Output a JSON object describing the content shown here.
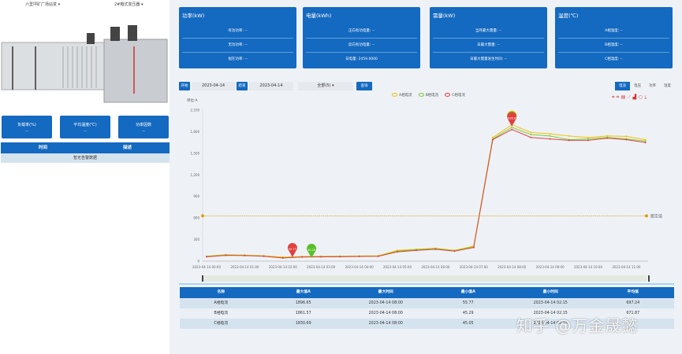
{
  "left": {
    "site_select": "六里坪矿广场站变 ▾",
    "device_select": "2#箱式变压器 ▾",
    "stats": [
      {
        "label": "负载率(%)",
        "value": "--"
      },
      {
        "label": "平均温度(℃)",
        "value": "--"
      },
      {
        "label": "功率因数",
        "value": "--"
      }
    ],
    "alarm_table": {
      "headers": [
        "时间",
        "描述"
      ],
      "empty": "暂无告警数据"
    }
  },
  "cards": [
    {
      "title": "功率(kW)",
      "rows": [
        "有功功率: --",
        "无功功率: --",
        "视在功率: --"
      ]
    },
    {
      "title": "电量(kWh)",
      "rows": [
        "正向有功电量: --",
        "反向有功电量: --",
        "日电量: 2459.0000"
      ]
    },
    {
      "title": "需量(kW)",
      "rows": [
        "当月最大需量: --",
        "日最大需量: --",
        "日最大需量发生时间: --"
      ]
    },
    {
      "title": "温度(℃)",
      "rows": [
        "A相温度: --",
        "B相温度: --",
        "C相温度: --"
      ]
    }
  ],
  "controls": {
    "start_label": "开始",
    "start_date": "2023-04-14",
    "end_label": "结束",
    "end_date": "2023-04-14",
    "filter": "全部(5) ▾",
    "query": "查询"
  },
  "tabs": [
    {
      "label": "电流",
      "active": true
    },
    {
      "label": "电压"
    },
    {
      "label": "功率"
    },
    {
      "label": "温度"
    }
  ],
  "toolbox": [
    "zoom-icon",
    "zoom-reset-icon",
    "data-view-icon",
    "line-icon",
    "bar-icon",
    "restore-icon",
    "download-icon"
  ],
  "chart_data": {
    "type": "line",
    "ylabel": "单位:A",
    "ylim": [
      0,
      2100
    ],
    "yticks": [
      "0",
      "300",
      "600",
      "900",
      "1,200",
      "1,500",
      "1,800",
      "2,100"
    ],
    "xticks": [
      "2023-04-14 00:00",
      "2023-04-14 01:00",
      "2023-04-14 02:00",
      "2023-04-14 03:00",
      "2023-04-14 04:00",
      "2023-04-14 05:00",
      "2023-04-14 06:00",
      "2023-04-14 07:00",
      "2023-04-14 08:00",
      "2023-04-14 09:00",
      "2023-04-14 10:00",
      "2023-04-14 11:00"
    ],
    "x_hours": [
      0,
      0.5,
      1,
      1.5,
      2,
      2.5,
      3,
      3.5,
      4,
      4.5,
      5,
      5.5,
      6,
      6.5,
      7,
      7.5,
      8,
      8.5,
      9,
      9.5,
      10,
      10.5,
      11,
      11.5
    ],
    "series": [
      {
        "name": "A相电流",
        "color": "#f2c200",
        "values": [
          70,
          90,
          85,
          75,
          56,
          65,
          68,
          70,
          72,
          75,
          150,
          165,
          180,
          150,
          210,
          1720,
          1897,
          1790,
          1770,
          1740,
          1720,
          1740,
          1735,
          1690
        ]
      },
      {
        "name": "B相电流",
        "color": "#7ccd3c",
        "values": [
          65,
          85,
          80,
          70,
          45,
          60,
          63,
          65,
          68,
          70,
          140,
          160,
          175,
          145,
          200,
          1700,
          1862,
          1760,
          1740,
          1690,
          1700,
          1720,
          1700,
          1670
        ]
      },
      {
        "name": "C相电流",
        "color": "#e0413e",
        "values": [
          60,
          80,
          78,
          68,
          45,
          58,
          60,
          62,
          65,
          68,
          130,
          150,
          165,
          140,
          190,
          1690,
          1831,
          1720,
          1700,
          1680,
          1680,
          1710,
          1690,
          1650
        ]
      }
    ],
    "markpoints": [
      {
        "label": "55.77",
        "color": "#e0413e",
        "x": 2.25,
        "y": 56
      },
      {
        "label": "45.29",
        "color": "#5bbf2a",
        "x": 2.75,
        "y": 45
      },
      {
        "label": "1896.65",
        "color": "#f2c200",
        "x": 8,
        "y": 1897
      },
      {
        "label": "1861.57",
        "color": "#5bbf2a",
        "x": 8,
        "y": 1862
      },
      {
        "label": "1830.69",
        "color": "#e0413e",
        "x": 8,
        "y": 1831
      }
    ],
    "threshold": {
      "label": "额定值",
      "value": 630,
      "color": "#e0a000"
    }
  },
  "table": {
    "headers": [
      "名称",
      "最大值A",
      "最大时间",
      "最小值A",
      "最小时间",
      "平均值"
    ],
    "rows": [
      [
        "A相电流",
        "1896.65",
        "2023-04-14 08:00",
        "55.77",
        "2023-04-14 02:15",
        "697.24"
      ],
      [
        "B相电流",
        "1861.57",
        "2023-04-14 08:00",
        "45.29",
        "2023-04-14 02:15",
        "671.87"
      ],
      [
        "C相电流",
        "1830.69",
        "2023-04-14 08:00",
        "45.05",
        "2023-04-14 02:15",
        ""
      ]
    ]
  },
  "watermark": "知乎 @万金晟懿"
}
